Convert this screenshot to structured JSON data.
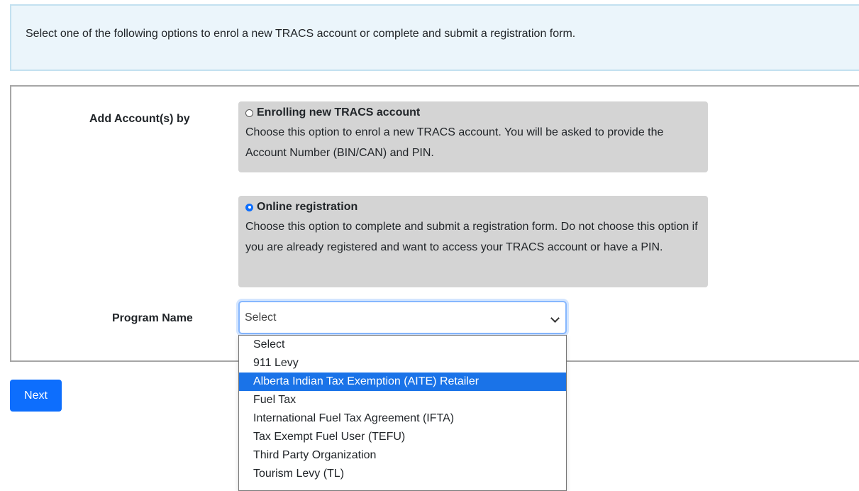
{
  "info": {
    "text": "Select one of the following options to enrol a new TRACS account or complete and submit a registration form."
  },
  "form": {
    "add_account_label": "Add Account(s) by",
    "options": [
      {
        "title": "Enrolling new TRACS account",
        "description": "Choose this option to enrol a new TRACS account. You will be asked to provide the Account Number (BIN/CAN) and PIN.",
        "checked": false
      },
      {
        "title": "Online registration",
        "description": "Choose this option to complete and submit a registration form. Do not choose this option if you are already registered and want to access your TRACS account or have a PIN.",
        "checked": true
      }
    ],
    "program_name_label": "Program Name",
    "program_select": {
      "value": "Select",
      "options": [
        "Select",
        "911 Levy",
        "Alberta Indian Tax Exemption (AITE) Retailer",
        "Fuel Tax",
        "International Fuel Tax Agreement (IFTA)",
        "Tax Exempt Fuel User (TEFU)",
        "Third Party Organization",
        "Tourism Levy (TL)"
      ],
      "highlighted": "Alberta Indian Tax Exemption (AITE) Retailer"
    }
  },
  "actions": {
    "next_label": "Next"
  },
  "colors": {
    "primary": "#0d6efd",
    "info_bg": "#ebf5fb",
    "info_border": "#c3e1f0",
    "option_bg": "#d4d4d4",
    "highlight": "#1a73e8"
  }
}
